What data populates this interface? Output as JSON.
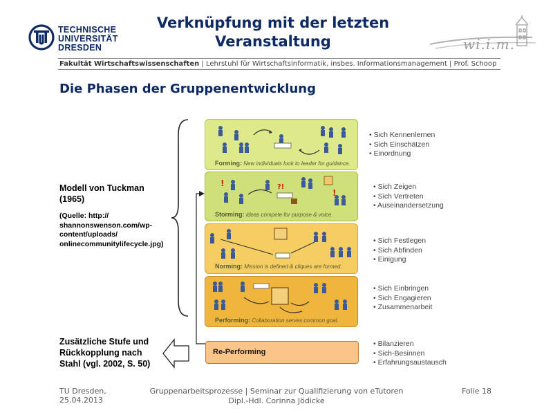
{
  "header": {
    "university_lines": [
      "TECHNISCHE",
      "UNIVERSITÄT",
      "DRESDEN"
    ],
    "title_line1": "Verknüpfung mit der letzten",
    "title_line2": "Veranstaltung",
    "faculty_bold": "Fakultät Wirtschaftswissenschaften",
    "faculty_rest": " | Lehrstuhl für Wirtschaftsinformatik, insbes. Informationsmanagement | Prof. Schoop",
    "logo_right_text": "wi.i.m."
  },
  "section_title": "Die Phasen der Gruppenentwicklung",
  "left_notes": {
    "tuckman_line1": "Modell von Tuckman",
    "tuckman_line2": "(1965)",
    "source_lines": [
      "(Quelle: http://",
      "shannonswenson.com/wp-",
      "content/uploads/",
      "onlinecommunitylifecycle.jpg)"
    ],
    "extra_lines": [
      "Zusätzliche Stufe und",
      "Rückkopplung nach",
      "Stahl (vgl. 2002, S. 50)"
    ]
  },
  "phases": [
    {
      "name": "Forming:",
      "desc": "New individuals look to leader for guidance.",
      "color": "#dde98a",
      "border": "#b5c64a",
      "bullets": [
        "Sich Kennenlernen",
        "Sich Einschätzen",
        "Einordnung"
      ]
    },
    {
      "name": "Storming:",
      "desc": "Ideas compete for purpose & voice.",
      "color": "#cfe07a",
      "border": "#a9bb3e",
      "bullets": [
        "Sich Zeigen",
        "Sich Vertreten",
        "Auseinandersetzung"
      ]
    },
    {
      "name": "Norming:",
      "desc": "Mission is defined & cliques are formed.",
      "color": "#f6cd62",
      "border": "#d7a43a",
      "bullets": [
        "Sich Festlegen",
        "Sich Abfinden",
        "Einigung"
      ]
    },
    {
      "name": "Performing:",
      "desc": "Collaboration serves common goal.",
      "color": "#f0b53c",
      "border": "#c98a22",
      "bullets": [
        "Sich Einbringen",
        "Sich Engagieren",
        "Zusammenarbeit"
      ]
    }
  ],
  "reperforming": {
    "label": "Re-Performing",
    "bullets": [
      "Bilanzieren",
      "Sich-Besinnen",
      "Erfahrungsaustausch"
    ]
  },
  "footer": {
    "left_line1": "TU Dresden,",
    "left_line2": "25.04.2013",
    "center_line1": "Gruppenarbeitsprozesse | Seminar zur Qualifizierung von eTutoren",
    "center_line2": "Dipl.-Hdl. Corinna Jödicke",
    "right": "Folie 18"
  },
  "colors": {
    "navy": "#0e2a64",
    "reperforming_fill": "#fbc58a",
    "reperforming_border": "#c9762a",
    "bullet_text": "#444444"
  },
  "icons": [
    "tu-dresden-logo-icon",
    "wiim-tower-logo-icon",
    "people-figures-icon",
    "arrow-icon",
    "brace-icon"
  ]
}
